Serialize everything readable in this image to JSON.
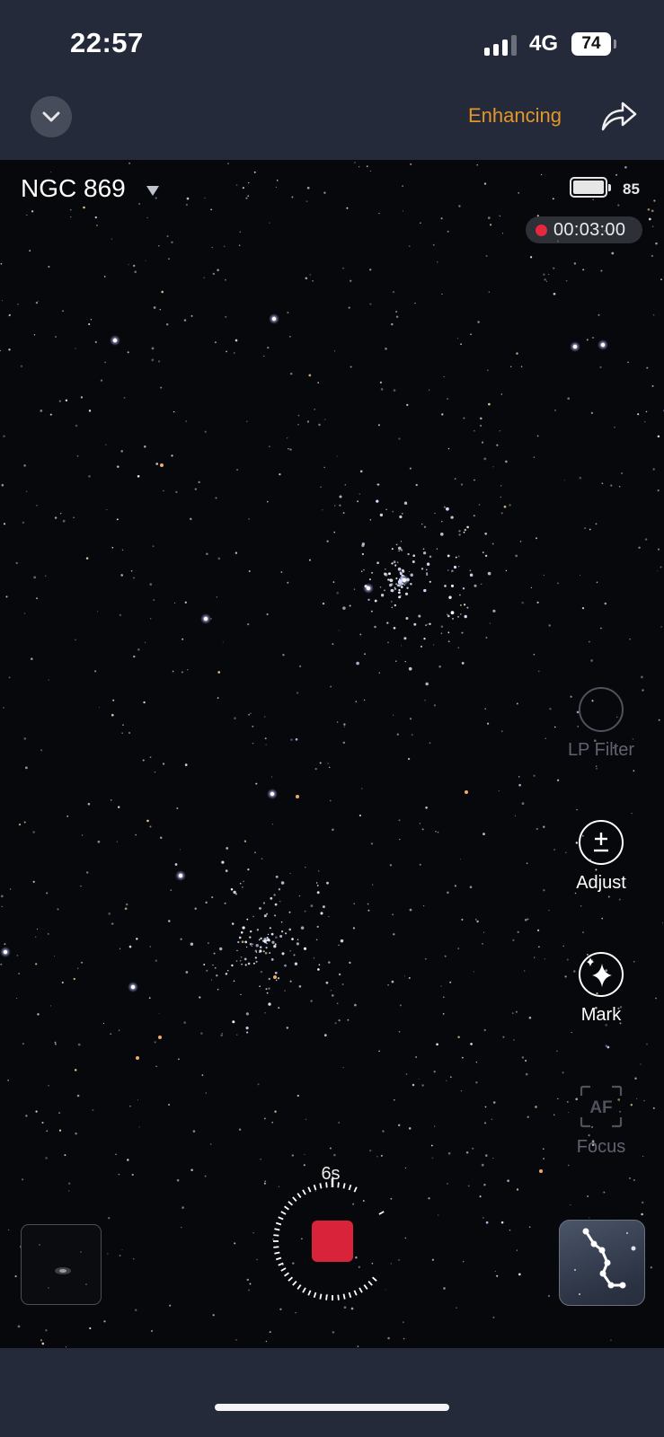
{
  "status_bar": {
    "time": "22:57",
    "network": "4G",
    "battery": "74"
  },
  "top_bar": {
    "status_text": "Enhancing",
    "collapse_icon": "chevron-down-icon",
    "share_icon": "share-icon"
  },
  "viewer": {
    "target_name": "NGC 869",
    "device_battery": "85",
    "exposure_time": "00:03:00",
    "recording": true
  },
  "tools": {
    "lp_filter": {
      "label": "LP Filter",
      "enabled": false,
      "icon": "circle-icon"
    },
    "adjust": {
      "label": "Adjust",
      "enabled": true,
      "icon": "plus-minus-icon"
    },
    "mark": {
      "label": "Mark",
      "enabled": true,
      "icon": "sparkle-icon"
    },
    "focus": {
      "label": "Focus",
      "enabled": false,
      "icon": "af-icon"
    }
  },
  "capture": {
    "countdown": "6s",
    "stop_icon": "stop-icon",
    "accent": "#d8233a"
  },
  "colors": {
    "accent_orange": "#e3962a",
    "record_red": "#e5283d",
    "bar_bg": "#252a3a"
  }
}
